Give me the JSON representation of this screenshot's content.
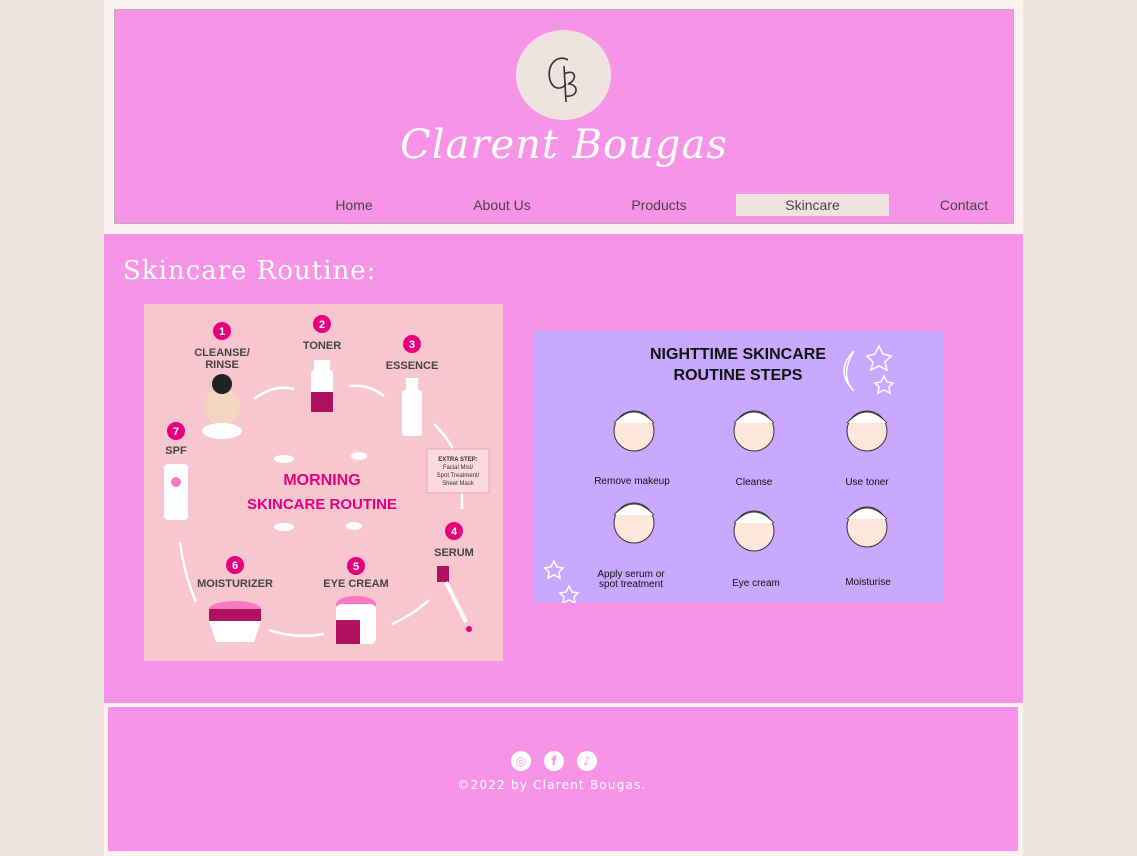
{
  "header": {
    "logo_monogram": "CB",
    "brand_name": "Clarent Bougas"
  },
  "nav": {
    "items": [
      {
        "label": "Home"
      },
      {
        "label": "About Us"
      },
      {
        "label": "Products"
      },
      {
        "label": "Skincare",
        "active": true
      },
      {
        "label": "Contact"
      }
    ]
  },
  "main": {
    "title": "Skincare Routine:",
    "morning_infographic": {
      "title_line1": "MORNING",
      "title_line2": "SKINCARE ROUTINE",
      "extra_step": [
        "EXTRA STEP:",
        "Facial Mist/",
        "Spot Treatment/",
        "Sheet Mask"
      ],
      "steps": [
        {
          "num": "1",
          "label_l1": "CLEANSE/",
          "label_l2": "RINSE"
        },
        {
          "num": "2",
          "label_l1": "TONER",
          "label_l2": ""
        },
        {
          "num": "3",
          "label_l1": "ESSENCE",
          "label_l2": ""
        },
        {
          "num": "4",
          "label_l1": "SERUM",
          "label_l2": ""
        },
        {
          "num": "5",
          "label_l1": "EYE CREAM",
          "label_l2": ""
        },
        {
          "num": "6",
          "label_l1": "MOISTURIZER",
          "label_l2": ""
        },
        {
          "num": "7",
          "label_l1": "SPF",
          "label_l2": ""
        }
      ]
    },
    "night_infographic": {
      "title_line1": "NIGHTTIME SKINCARE",
      "title_line2": "ROUTINE STEPS",
      "steps": [
        {
          "l1": "Remove makeup",
          "l2": ""
        },
        {
          "l1": "Cleanse",
          "l2": ""
        },
        {
          "l1": "Use toner",
          "l2": ""
        },
        {
          "l1": "Apply serum or",
          "l2": "spot treatment"
        },
        {
          "l1": "Eye cream",
          "l2": ""
        },
        {
          "l1": "Moisturise",
          "l2": ""
        }
      ]
    }
  },
  "footer": {
    "social_icons": [
      "instagram-icon",
      "facebook-icon",
      "tiktok-icon"
    ],
    "social_glyphs": [
      "◎",
      "f",
      "♪"
    ],
    "copyright": "©2022 by Clarent Bougas."
  },
  "colors": {
    "pink": "#f794e8",
    "cream": "#efe3df",
    "magenta": "#e6007e",
    "lavender": "#c9a9ff"
  }
}
